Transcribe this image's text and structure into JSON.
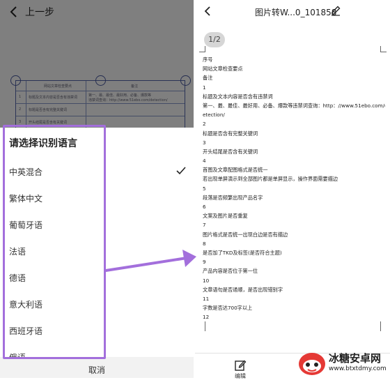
{
  "left_panel": {
    "header": {
      "back_label": "上一步"
    },
    "doc_table": {
      "header": [
        "",
        "网站文章检查要点",
        "备注"
      ],
      "rows": [
        [
          "1",
          "标题及文本内容是否含有违禁词",
          "第一、最、最佳、最好用、必备、爆款等"
        ],
        [
          "2",
          "标题是否含有完整关键词",
          "违禁词查询：http://www.51ebo.com/detection/"
        ],
        [
          "3",
          "开头结尾是否含有关键词",
          ""
        ]
      ]
    },
    "sheet": {
      "title": "请选择识别语言",
      "languages": [
        {
          "label": "中英混合",
          "selected": true
        },
        {
          "label": "繁体中文",
          "selected": false
        },
        {
          "label": "葡萄牙语",
          "selected": false
        },
        {
          "label": "法语",
          "selected": false
        },
        {
          "label": "德语",
          "selected": false
        },
        {
          "label": "意大利语",
          "selected": false
        },
        {
          "label": "西班牙语",
          "selected": false
        },
        {
          "label": "俄语",
          "selected": false
        }
      ],
      "cancel_label": "取消"
    },
    "highlight_color": "#a36fdc"
  },
  "right_panel": {
    "header": {
      "title": "图片转W...0_101858"
    },
    "page_badge": "1/2",
    "doc_lines": [
      "序号",
      "网站文章检查要点",
      "备注",
      "1",
      "标题及文本内容是否含有违禁词",
      "第一、最、最佳、最好用、必备、爆款等违禁词查询：http：//www.51ebo.com/d",
      "etection/",
      "2",
      "标题是否含有完整关键词",
      "3",
      "开头结尾是否含有关键词",
      "4",
      "首图及文章配图格式是否统一",
      "若出现单屏演示到全部图片都是单屏显示，操作界面需要描边",
      "5",
      "段落是否频繁出现产品名字",
      "6",
      "文案及图片是否重复",
      "7",
      "图片格式是否统一出现白边是否有描边",
      "8",
      "是否加了TKD及标签(是否符合主题)",
      "9",
      "产品内容是否位于第一位",
      "10",
      "文章语句是否通顺，是否出现错别字",
      "11",
      "字数是否达700字以上",
      "12"
    ],
    "bottom_tab": {
      "label": "编辑"
    }
  },
  "watermark": {
    "name": "冰糖安卓网",
    "url": "www.btxtdmy.com"
  }
}
